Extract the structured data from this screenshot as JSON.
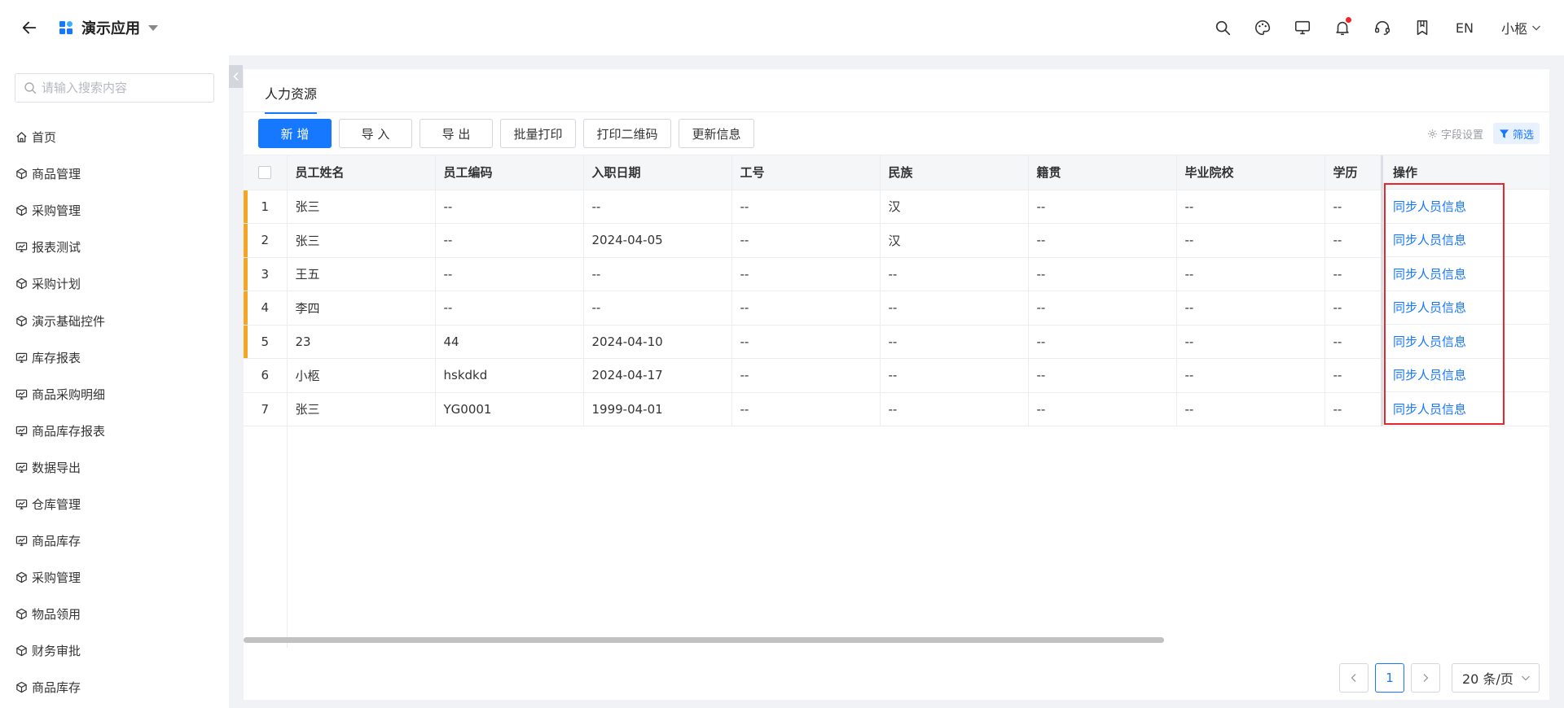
{
  "header": {
    "app_name": "演示应用",
    "lang": "EN",
    "user": "小柩"
  },
  "sidebar": {
    "search_placeholder": "请输入搜索内容",
    "items": [
      {
        "label": "首页",
        "icon": "home-icon"
      },
      {
        "label": "商品管理",
        "icon": "cube-icon"
      },
      {
        "label": "采购管理",
        "icon": "cube-icon"
      },
      {
        "label": "报表测试",
        "icon": "report-icon"
      },
      {
        "label": "采购计划",
        "icon": "cube-icon"
      },
      {
        "label": "演示基础控件",
        "icon": "cube-icon"
      },
      {
        "label": "库存报表",
        "icon": "report-icon"
      },
      {
        "label": "商品采购明细",
        "icon": "report-icon"
      },
      {
        "label": "商品库存报表",
        "icon": "report-icon"
      },
      {
        "label": "数据导出",
        "icon": "report-icon"
      },
      {
        "label": "仓库管理",
        "icon": "report-icon"
      },
      {
        "label": "商品库存",
        "icon": "report-icon"
      },
      {
        "label": "采购管理",
        "icon": "cube-icon"
      },
      {
        "label": "物品领用",
        "icon": "cube-icon"
      },
      {
        "label": "财务审批",
        "icon": "cube-icon"
      },
      {
        "label": "商品库存",
        "icon": "cube-icon"
      }
    ]
  },
  "main": {
    "tab_label": "人力资源",
    "toolbar": {
      "new_label": "新 增",
      "import_label": "导 入",
      "export_label": "导 出",
      "batch_print_label": "批量打印",
      "print_qr_label": "打印二维码",
      "update_info_label": "更新信息",
      "field_settings_label": "字段设置",
      "filter_label": "筛选"
    },
    "table": {
      "columns": [
        "员工姓名",
        "员工编码",
        "入职日期",
        "工号",
        "民族",
        "籍贯",
        "毕业院校",
        "学历"
      ],
      "op_header": "操作",
      "rows": [
        {
          "idx": "1",
          "cells": [
            "张三",
            "--",
            "--",
            "--",
            "汉",
            "--",
            "--",
            "--"
          ],
          "op": "同步人员信息",
          "marked": true
        },
        {
          "idx": "2",
          "cells": [
            "张三",
            "--",
            "2024-04-05",
            "--",
            "汉",
            "--",
            "--",
            "--"
          ],
          "op": "同步人员信息",
          "marked": true
        },
        {
          "idx": "3",
          "cells": [
            "王五",
            "--",
            "--",
            "--",
            "--",
            "--",
            "--",
            "--"
          ],
          "op": "同步人员信息",
          "marked": true
        },
        {
          "idx": "4",
          "cells": [
            "李四",
            "--",
            "--",
            "--",
            "--",
            "--",
            "--",
            "--"
          ],
          "op": "同步人员信息",
          "marked": true
        },
        {
          "idx": "5",
          "cells": [
            "23",
            "44",
            "2024-04-10",
            "--",
            "--",
            "--",
            "--",
            "--"
          ],
          "op": "同步人员信息",
          "marked": true
        },
        {
          "idx": "6",
          "cells": [
            "小柩",
            "hskdkd",
            "2024-04-17",
            "--",
            "--",
            "--",
            "--",
            "--"
          ],
          "op": "同步人员信息",
          "marked": false
        },
        {
          "idx": "7",
          "cells": [
            "张三",
            "YG0001",
            "1999-04-01",
            "--",
            "--",
            "--",
            "--",
            "--"
          ],
          "op": "同步人员信息",
          "marked": false
        }
      ]
    },
    "pagination": {
      "current_page": "1",
      "page_size": "20 条/页"
    }
  },
  "colors": {
    "accent": "#1677ff",
    "row_marker": "#f5a623",
    "highlight_box": "#e8262b"
  }
}
